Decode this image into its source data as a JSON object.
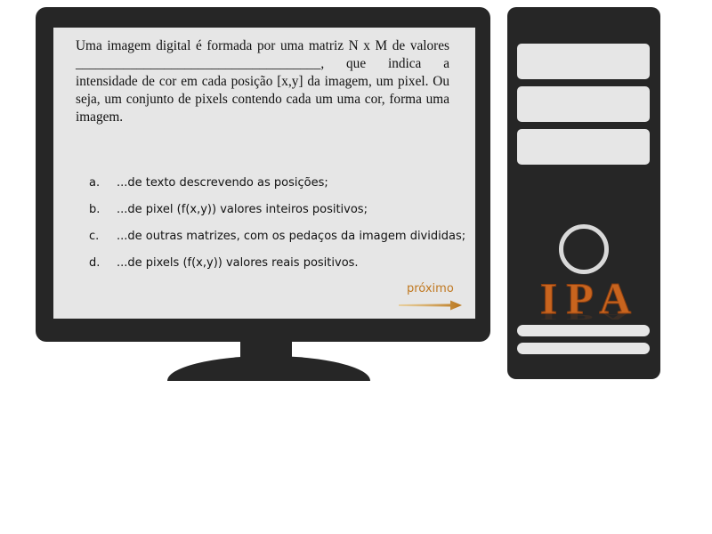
{
  "question": {
    "text": "Uma imagem digital é formada por uma matriz N x M de valores ____________________________________, que indica a intensidade de cor em cada posição [x,y] da imagem, um pixel. Ou seja, um conjunto de pixels contendo cada um uma cor, forma uma imagem."
  },
  "options": [
    {
      "letter": "a.",
      "text": "...de texto descrevendo as posições;"
    },
    {
      "letter": "b.",
      "text": "...de pixel (f(x,y)) valores inteiros positivos;"
    },
    {
      "letter": "c.",
      "text": "...de outras matrizes, com os pedaços da imagem divididas;"
    },
    {
      "letter": "d.",
      "text": "...de pixels (f(x,y)) valores reais positivos."
    }
  ],
  "navigation": {
    "next_label": "próximo"
  },
  "logo": {
    "text": "IPA"
  },
  "colors": {
    "accent": "#c07820",
    "logo": "#c8641e",
    "case": "#262626",
    "screen": "#e6e6e6"
  },
  "icons": {
    "next": "right-arrow-icon",
    "power": "power-button-icon"
  }
}
